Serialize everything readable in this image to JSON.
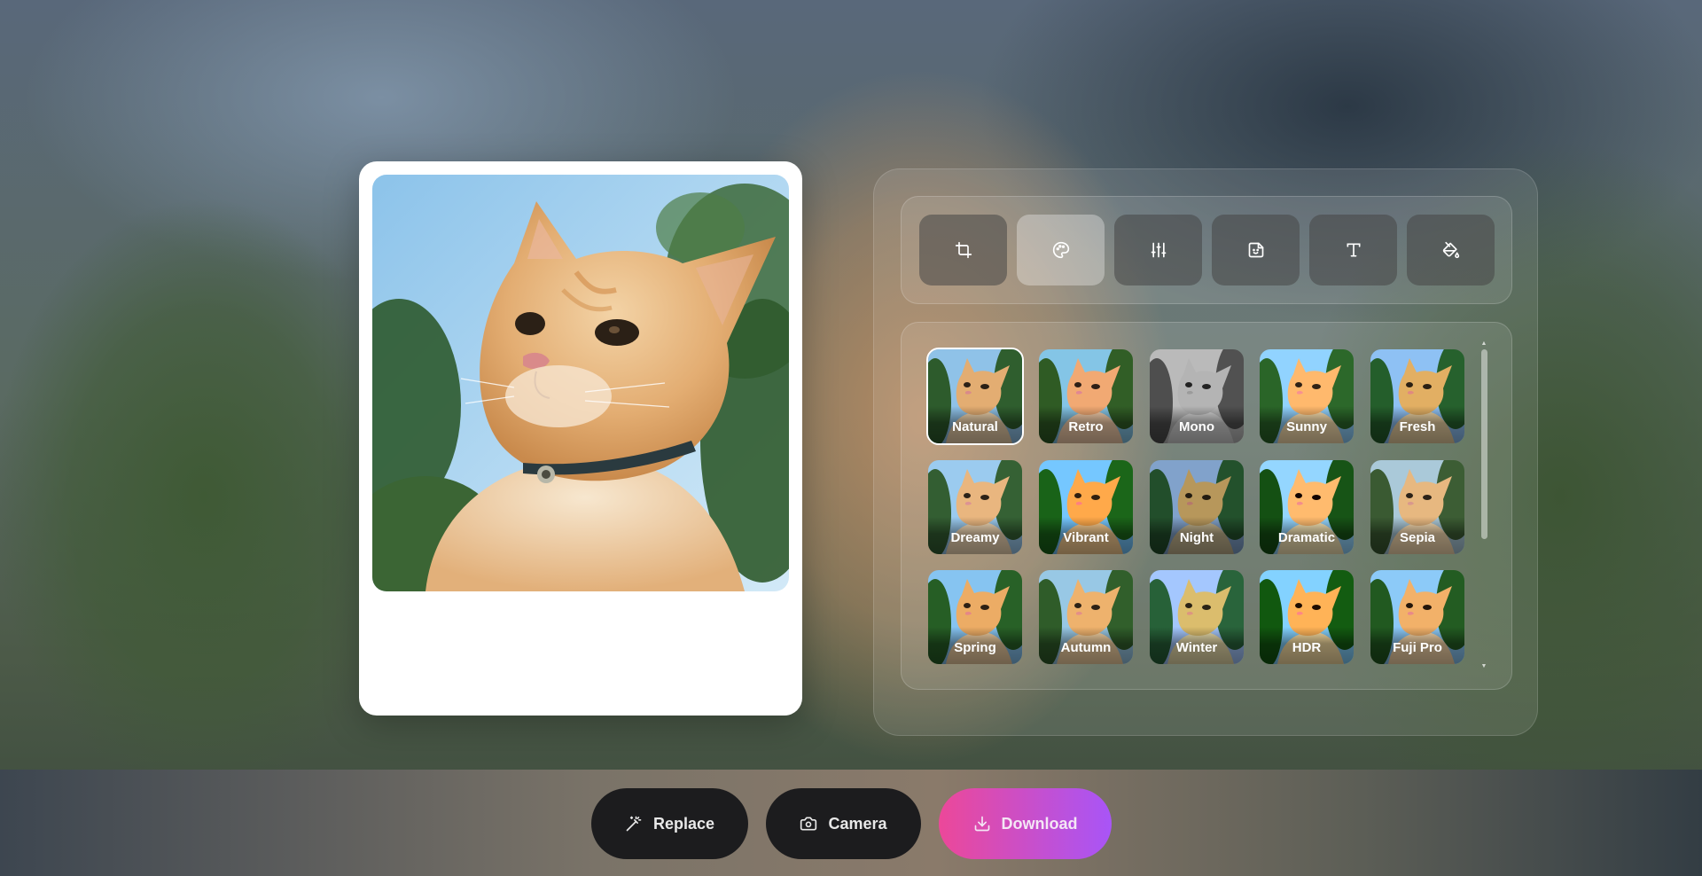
{
  "toolbar": {
    "tools": [
      {
        "icon": "crop-icon",
        "active": false
      },
      {
        "icon": "palette-icon",
        "active": true
      },
      {
        "icon": "sliders-icon",
        "active": false
      },
      {
        "icon": "sticker-icon",
        "active": false
      },
      {
        "icon": "text-icon",
        "active": false
      },
      {
        "icon": "paint-bucket-icon",
        "active": false
      }
    ]
  },
  "filters": [
    {
      "label": "Natural",
      "selected": true
    },
    {
      "label": "Retro"
    },
    {
      "label": "Mono"
    },
    {
      "label": "Sunny"
    },
    {
      "label": "Fresh"
    },
    {
      "label": "Dreamy"
    },
    {
      "label": "Vibrant"
    },
    {
      "label": "Night"
    },
    {
      "label": "Dramatic"
    },
    {
      "label": "Sepia"
    },
    {
      "label": "Spring"
    },
    {
      "label": "Autumn"
    },
    {
      "label": "Winter"
    },
    {
      "label": "HDR"
    },
    {
      "label": "Fuji Pro"
    }
  ],
  "actions": {
    "replace_label": "Replace",
    "camera_label": "Camera",
    "download_label": "Download"
  },
  "colors": {
    "download_gradient_start": "#ec4899",
    "download_gradient_end": "#a855f7",
    "button_dark": "#1c1c1e"
  }
}
